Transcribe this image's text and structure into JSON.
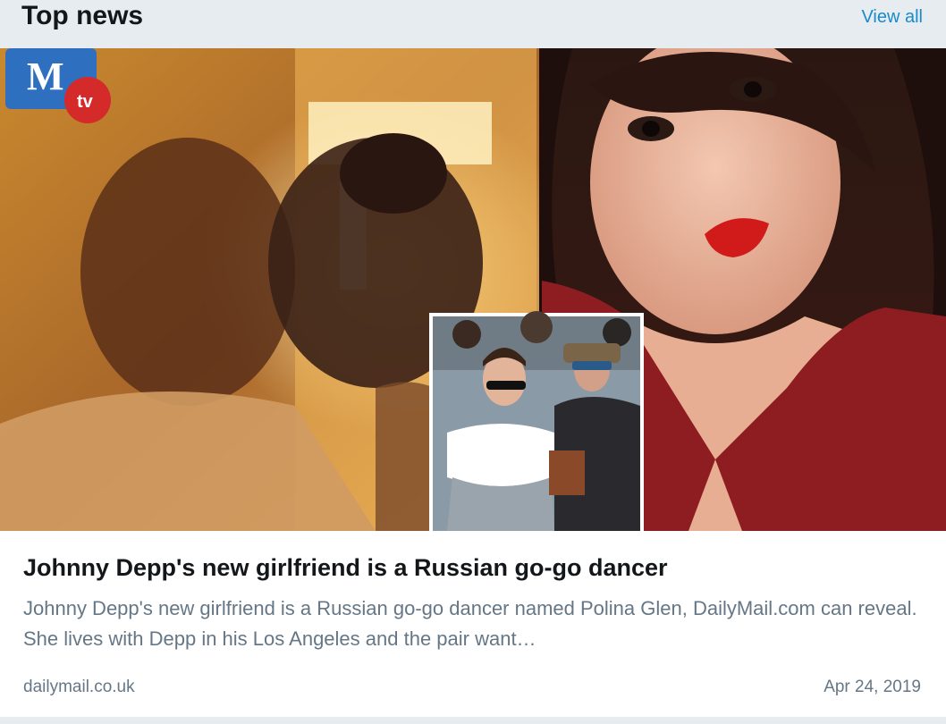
{
  "header": {
    "title": "Top news",
    "view_all_label": "View all"
  },
  "article": {
    "image_badge_text": "tv",
    "headline": "Johnny Depp's new girlfriend is a Russian go-go dancer",
    "summary": "Johnny Depp's new girlfriend is a Russian go-go dancer named Polina Glen, DailyMail.com can reveal. She lives with Depp in his Los Angeles and the pair want…",
    "source": "dailymail.co.uk",
    "date": "Apr 24, 2019"
  },
  "colors": {
    "background": "#e6ecf0",
    "link": "#1b8ac8",
    "headline": "#14171a",
    "muted": "#657786",
    "logo_blue": "#2f6fc0",
    "logo_badge_red": "#d42a2a"
  }
}
